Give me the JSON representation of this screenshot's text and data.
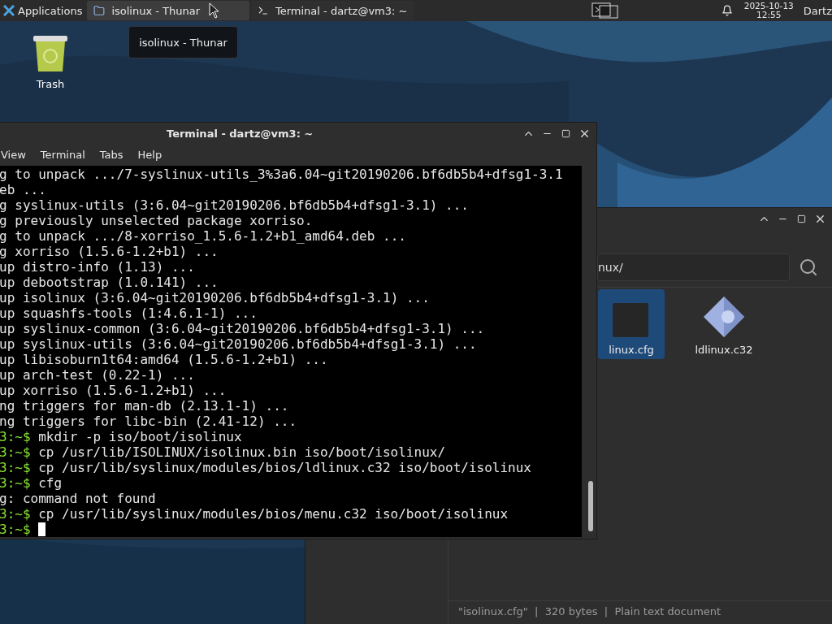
{
  "panel": {
    "applications": "Applications",
    "tasks": [
      {
        "title": "isolinux - Thunar",
        "kind": "folder",
        "selected": true
      },
      {
        "title": "Terminal - dartz@vm3: ~",
        "kind": "terminal",
        "selected": false
      }
    ],
    "date": "2025-10-13",
    "time": "12:55",
    "user": "Dartz"
  },
  "tooltip": "isolinux - Thunar",
  "desktop_icons": [
    {
      "label": "Trash"
    }
  ],
  "file_manager": {
    "path": "nux/",
    "files": [
      {
        "name": "linux.cfg",
        "kind": "text",
        "selected": true
      },
      {
        "name": "ldlinux.c32",
        "kind": "binary",
        "selected": false
      }
    ],
    "status": "\"isolinux.cfg\"  |  320 bytes  |  Plain text document"
  },
  "terminal": {
    "title": "Terminal - dartz@vm3: ~",
    "menu": [
      "View",
      "Terminal",
      "Tabs",
      "Help"
    ],
    "lines": [
      {
        "text": "g to unpack .../7-syslinux-utils_3%3a6.04~git20190206.bf6db5b4+dfsg1-3.1"
      },
      {
        "text": "eb ..."
      },
      {
        "text": "g syslinux-utils (3:6.04~git20190206.bf6db5b4+dfsg1-3.1) ..."
      },
      {
        "text": "g previously unselected package xorriso."
      },
      {
        "text": "g to unpack .../8-xorriso_1.5.6-1.2+b1_amd64.deb ..."
      },
      {
        "text": "g xorriso (1.5.6-1.2+b1) ..."
      },
      {
        "text": "up distro-info (1.13) ..."
      },
      {
        "text": "up debootstrap (1.0.141) ..."
      },
      {
        "text": "up isolinux (3:6.04~git20190206.bf6db5b4+dfsg1-3.1) ..."
      },
      {
        "text": "up squashfs-tools (1:4.6.1-1) ..."
      },
      {
        "text": "up syslinux-common (3:6.04~git20190206.bf6db5b4+dfsg1-3.1) ..."
      },
      {
        "text": "up syslinux-utils (3:6.04~git20190206.bf6db5b4+dfsg1-3.1) ..."
      },
      {
        "text": "up libisoburn1t64:amd64 (1.5.6-1.2+b1) ..."
      },
      {
        "text": "up arch-test (0.22-1) ..."
      },
      {
        "text": "up xorriso (1.5.6-1.2+b1) ..."
      },
      {
        "text": "ng triggers for man-db (2.13.1-1) ..."
      },
      {
        "text": "ng triggers for libc-bin (2.41-12) ..."
      },
      {
        "prompt": "3:~$",
        "text": "mkdir -p iso/boot/isolinux"
      },
      {
        "prompt": "3:~$",
        "text": "cp /usr/lib/ISOLINUX/isolinux.bin iso/boot/isolinux/"
      },
      {
        "prompt": "3:~$",
        "text": "cp /usr/lib/syslinux/modules/bios/ldlinux.c32 iso/boot/isolinux"
      },
      {
        "prompt": "3:~$",
        "text": "cfg"
      },
      {
        "text": "g: command not found"
      },
      {
        "prompt": "3:~$",
        "text": "cp /usr/lib/syslinux/modules/bios/menu.c32 iso/boot/isolinux"
      },
      {
        "prompt": "3:~$"
      }
    ]
  }
}
